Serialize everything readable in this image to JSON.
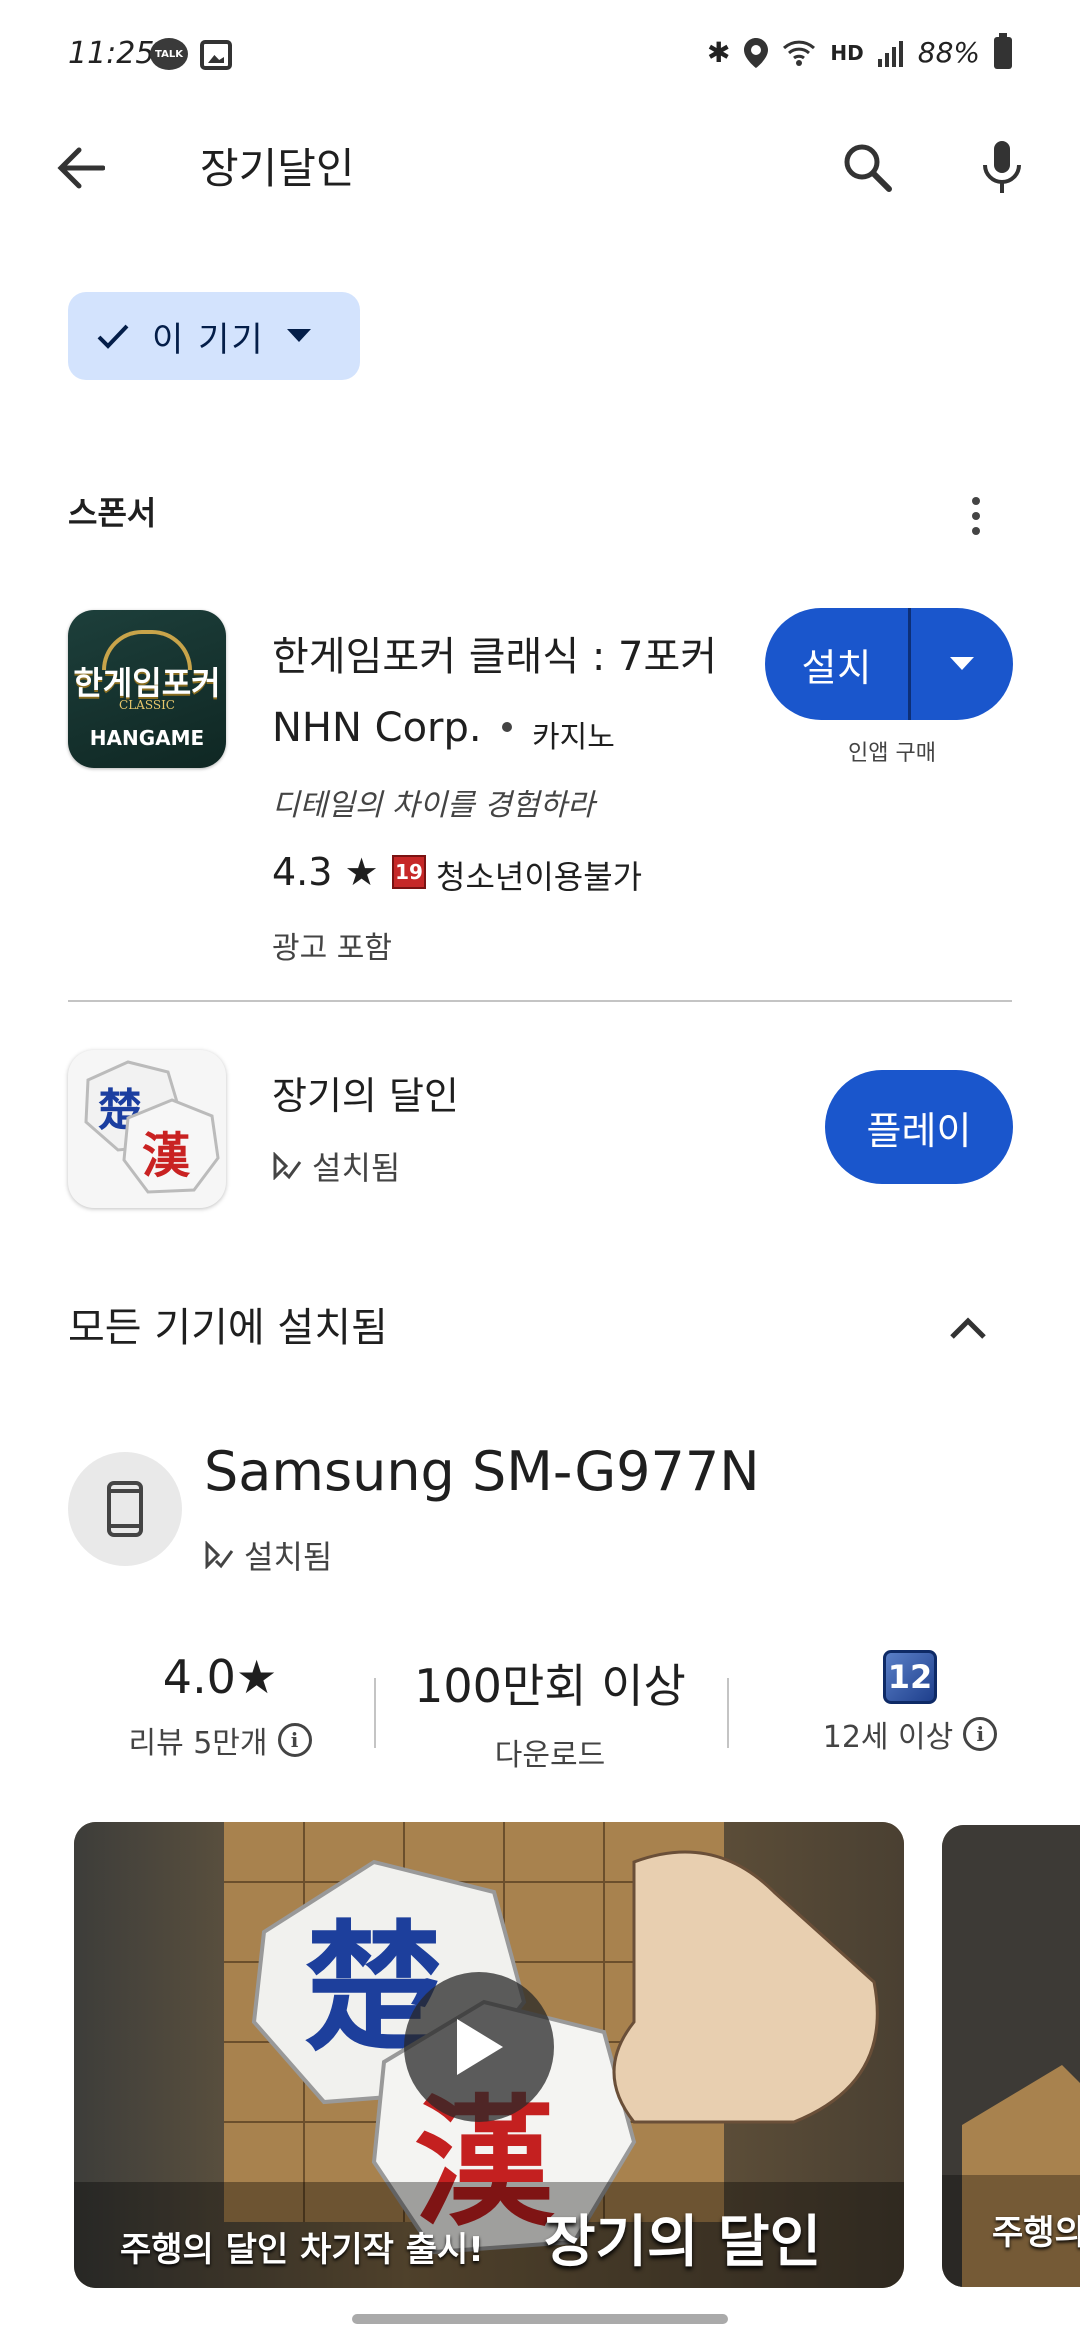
{
  "status_bar": {
    "time": "11:25",
    "talk_label": "TALK",
    "hd_label": "HD",
    "battery": "88%"
  },
  "search": {
    "query": "장기달인"
  },
  "filter_chip": {
    "label": "이 기기"
  },
  "sponsor": {
    "title": "스폰서",
    "app": {
      "icon_main": "한게임포커",
      "icon_classic": "CLASSIC",
      "icon_brand": "HANGAME",
      "title": "한게임포커 클래식 : 7포커 ...",
      "developer": "NHN Corp.",
      "category": "카지노",
      "tagline": "디테일의 차이를 경험하라",
      "rating": "4.3 ★",
      "age_badge": "19",
      "age_label": "청소년이용불가",
      "ads": "광고 포함",
      "install_label": "설치",
      "install_note": "인앱 구매"
    }
  },
  "result_app": {
    "title": "장기의 달인",
    "status": "설치됨",
    "play_label": "플레이"
  },
  "all_devices": {
    "title": "모든 기기에 설치됨",
    "device_name": "Samsung SM-G977N",
    "device_status": "설치됨"
  },
  "stats": {
    "rating_value": "4.0★",
    "rating_label": "리뷰 5만개",
    "downloads_value": "100만회 이상",
    "downloads_label": "다운로드",
    "age_label": "12세 이상"
  },
  "media": {
    "caption_left": "주행의 달인 차기작 출시!",
    "caption_right": "장기의 달인",
    "caption_second": "주행의"
  }
}
